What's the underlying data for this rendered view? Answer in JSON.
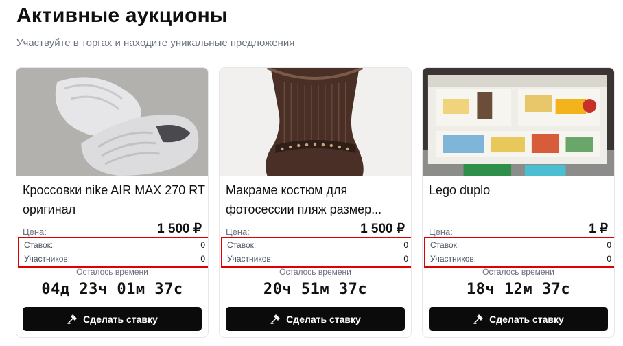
{
  "header": {
    "title": "Активные аукционы",
    "subtitle": "Участвуйте в торгах и находите уникальные предложения"
  },
  "auctions": [
    {
      "title": "Кроссовки nike AIR MAX 270 RT оригинал",
      "price_label": "Цена:",
      "price": "1 500 ₽",
      "bids_label": "Ставок:",
      "bids": "0",
      "participants_label": "Участников:",
      "participants": "0",
      "time_label": "Осталось времени",
      "time_left": "04д 23ч 01м 37с",
      "button_label": "Сделать ставку",
      "image_subject": "white-sneakers-photo"
    },
    {
      "title": "Макраме костюм для фотосессии пляж размер...",
      "price_label": "Цена:",
      "price": "1 500 ₽",
      "bids_label": "Ставок:",
      "bids": "0",
      "participants_label": "Участников:",
      "participants": "0",
      "time_label": "Осталось времени",
      "time_left": "20ч 51м 37с",
      "button_label": "Сделать ставку",
      "image_subject": "macrame-costume-photo"
    },
    {
      "title": "Lego duplo",
      "price_label": "Цена:",
      "price": "1 ₽",
      "bids_label": "Ставок:",
      "bids": "0",
      "participants_label": "Участников:",
      "participants": "0",
      "time_label": "Осталось времени",
      "time_left": "18ч 12м 37с",
      "button_label": "Сделать ставку",
      "image_subject": "lego-duplo-house-photo"
    }
  ],
  "colors": {
    "button_bg": "#0b0b0b",
    "highlight_border": "#e00000",
    "muted_text": "#6b7280"
  },
  "icons": {
    "bid_button": "gavel-icon"
  }
}
